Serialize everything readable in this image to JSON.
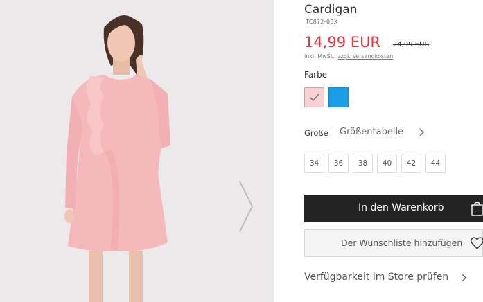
{
  "product": {
    "title": "Cardigan",
    "sku": "TC872-03X",
    "price": "14,99 EUR",
    "old_price": "24,99 EUR",
    "tax_prefix": "inkl. MwSt.,",
    "shipping_link": "zzgl. Versandkosten"
  },
  "colors": {
    "label": "Farbe",
    "options": [
      {
        "name": "pink",
        "hex": "#f7d1d3",
        "selected": true
      },
      {
        "name": "blue",
        "hex": "#1a9ee6",
        "selected": false
      }
    ]
  },
  "sizes": {
    "label": "Größe",
    "guide_label": "Größentabelle",
    "options": [
      "34",
      "36",
      "38",
      "40",
      "42",
      "44"
    ]
  },
  "actions": {
    "cart_label": "In den Warenkorb",
    "wishlist_label": "Der Wunschliste hinzufügen",
    "availability_label": "Verfügbarkeit im Store prüfen"
  },
  "icons": {
    "next": "chevron-right-icon",
    "cart": "shopping-bag-icon",
    "wishlist": "heart-icon",
    "check": "check-icon"
  }
}
